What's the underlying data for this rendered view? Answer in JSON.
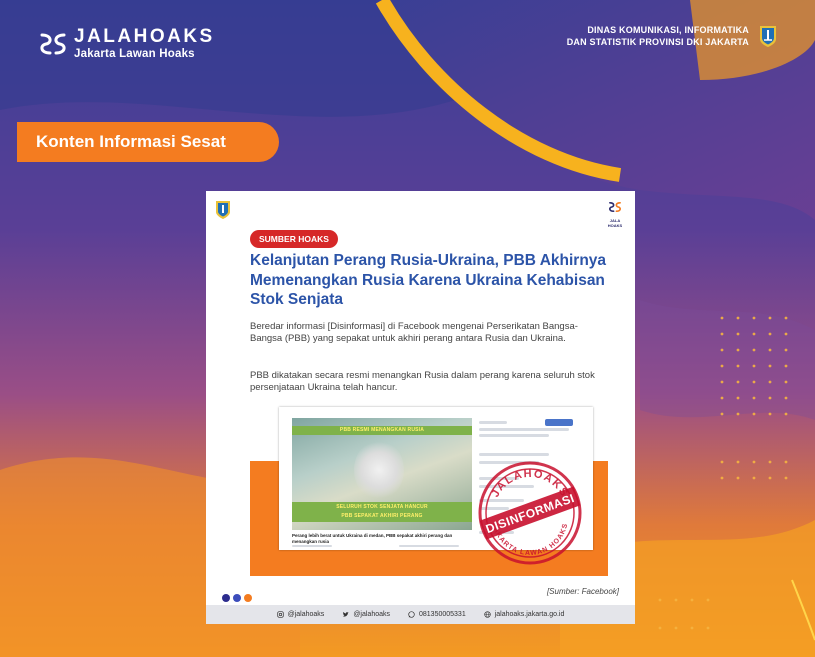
{
  "header": {
    "brand": "JALAHOAKS",
    "tagline": "Jakarta Lawan Hoaks",
    "org_line1": "DINAS KOMUNIKASI, INFORMATIKA",
    "org_line2": "DAN STATISTIK PROVINSI DKI JAKARTA"
  },
  "category_label": "Konten Informasi Sesat",
  "card": {
    "label": "SUMBER HOAKS",
    "headline": "Kelanjutan Perang Rusia-Ukraina, PBB Akhirnya Memenangkan Rusia Karena Ukraina Kehabisan Stok Senjata",
    "paragraph1": "Beredar informasi [Disinformasi] di Facebook mengenai Perserikatan Bangsa-Bangsa (PBB) yang sepakat untuk akhiri perang antara Rusia dan Ukraina.",
    "paragraph2": "PBB dikatakan secara resmi menangkan Rusia dalam perang karena seluruh stok persenjataan Ukraina telah hancur.",
    "source": "[Sumber: Facebook]",
    "logo_small": "JALA HOAKS"
  },
  "screenshot": {
    "banner_top": "PBB RESMI MENANGKAN RUSIA",
    "banner_bottom_1": "SELURUH STOK SENJATA HANCUR",
    "banner_bottom_2": "PBB SEPAKAT AKHIRI PERANG",
    "caption": "Perang lebih berat untuk Ukraina di medan, PBB sepakat akhiri perang dan menangkan rusia"
  },
  "stamp": {
    "top_text": "JALAHOAKS",
    "middle_text": "DISINFORMASI",
    "bottom_text": "JAKARTA LAWAN HOAKS"
  },
  "footer": {
    "instagram": "@jalahoaks",
    "twitter": "@jalahoaks",
    "whatsapp": "081350005331",
    "website": "jalahoaks.jakarta.go.id"
  },
  "colors": {
    "accent_orange": "#f47c20",
    "headline_blue": "#2c54a8",
    "label_red": "#d62828",
    "stamp_red": "#c8102e",
    "background_purple": "#4b3b8f"
  }
}
